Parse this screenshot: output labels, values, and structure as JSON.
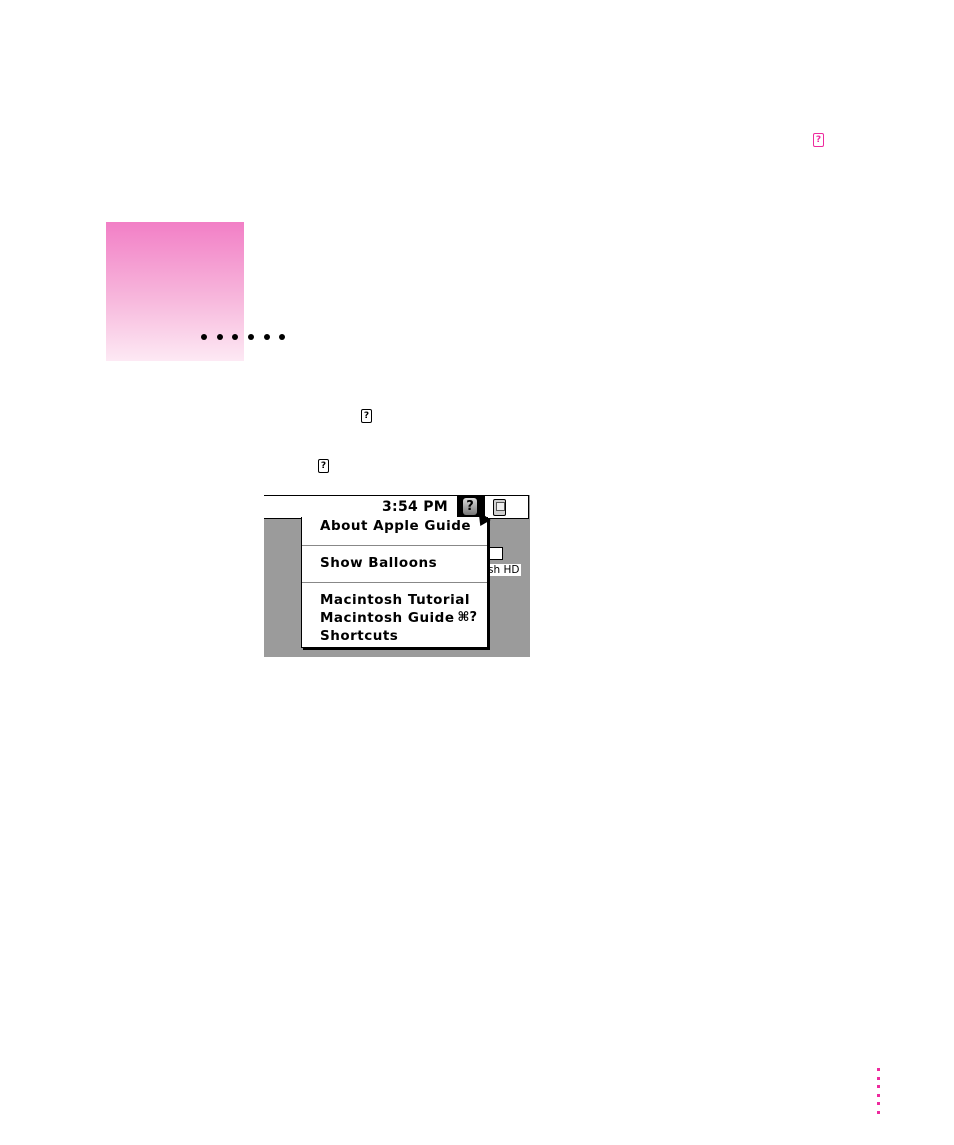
{
  "page": {
    "accent_color": "#ee2a9e",
    "header_icon": "help-guide-icon",
    "chapter_marker": {
      "dots": 6
    },
    "inline_icons": [
      "help-guide-icon",
      "help-guide-icon"
    ],
    "page_marker_dots": 6
  },
  "illustration": {
    "menubar": {
      "clock": "3:54 PM",
      "help_menu_icon": "?",
      "application_icon": "finder-icon"
    },
    "desktop": {
      "disk_label": "sh HD"
    },
    "help_menu": {
      "items": [
        {
          "label": "About Apple Guide"
        },
        {
          "label": "Show Balloons"
        },
        {
          "label": "Macintosh Tutorial"
        },
        {
          "label": "Macintosh Guide",
          "shortcut": "⌘?"
        },
        {
          "label": "Shortcuts"
        }
      ]
    }
  }
}
